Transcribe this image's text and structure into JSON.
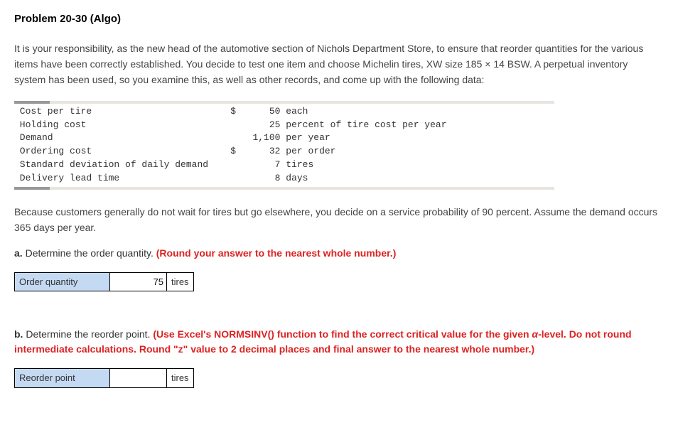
{
  "title": "Problem 20-30 (Algo)",
  "intro": "It is your responsibility, as the new head of the automotive section of Nichols Department Store, to ensure that reorder quantities for the various items have been correctly established. You decide to test one item and choose Michelin tires, XW size 185 × 14 BSW. A perpetual inventory system has been used, so you examine this, as well as other records, and come up with the following data:",
  "data_rows": [
    {
      "label": "Cost per tire",
      "prefix": "$",
      "value": "50",
      "unit": "each"
    },
    {
      "label": "Holding cost",
      "prefix": "",
      "value": "25",
      "unit": "percent of tire cost per year"
    },
    {
      "label": "Demand",
      "prefix": "",
      "value": "1,100",
      "unit": "per year"
    },
    {
      "label": "Ordering cost",
      "prefix": "$",
      "value": "32",
      "unit": "per order"
    },
    {
      "label": "Standard deviation of daily demand",
      "prefix": "",
      "value": "7",
      "unit": "tires"
    },
    {
      "label": "Delivery lead time",
      "prefix": "",
      "value": "8",
      "unit": "days"
    }
  ],
  "followup": "Because customers generally do not wait for tires but go elsewhere, you decide on a service probability of 90 percent. Assume the demand occurs 365 days per year.",
  "part_a": {
    "letter": "a.",
    "text": "Determine the order quantity.",
    "hint": "(Round your answer to the nearest whole number.)",
    "label": "Order quantity",
    "value": "75",
    "unit": "tires"
  },
  "part_b": {
    "letter": "b.",
    "text": "Determine the reorder point.",
    "hint_pre": "(Use Excel's NORMSINV() function to find the correct critical value for the given ",
    "hint_alpha": "α",
    "hint_post": "-level. Do not round intermediate calculations. Round ",
    "hint_z": "\"z\"",
    "hint_end": " value to 2 decimal places and final answer to the nearest whole number.)",
    "label": "Reorder point",
    "value": "",
    "unit": "tires"
  }
}
